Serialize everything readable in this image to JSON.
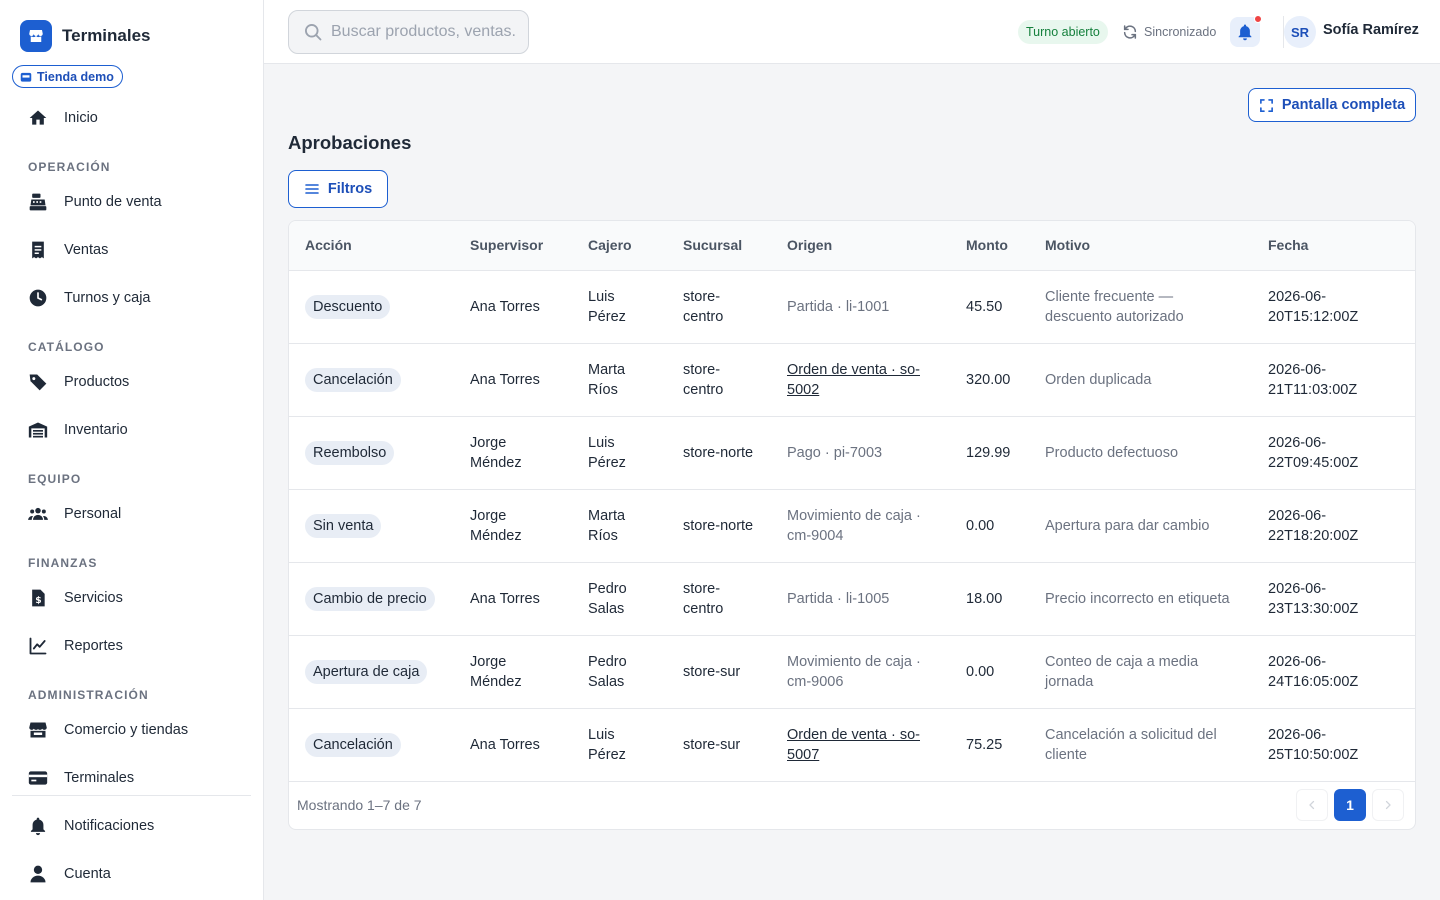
{
  "app": {
    "name": "Terminales",
    "store": "Tienda demo"
  },
  "nav": {
    "home": "Inicio",
    "sections": {
      "operation": "OPERACIÓN",
      "catalog": "CATÁLOGO",
      "team": "EQUIPO",
      "finance": "FINANZAS",
      "admin": "ADMINISTRACIÓN"
    },
    "items": {
      "pos": "Punto de venta",
      "sales": "Ventas",
      "shifts": "Turnos y caja",
      "products": "Productos",
      "inventory": "Inventario",
      "staff": "Personal",
      "services": "Servicios",
      "reports": "Reportes",
      "stores": "Comercio y tiendas",
      "terminals": "Terminales",
      "notifications": "Notificaciones",
      "account": "Cuenta"
    }
  },
  "topbar": {
    "search_placeholder": "Buscar productos, ventas...",
    "shift_status": "Turno abierto",
    "sync_status": "Sincronizado",
    "user_initials": "SR",
    "user_name": "Sofía Ramírez"
  },
  "page": {
    "title": "Aprobaciones",
    "fullscreen_label": "Pantalla completa",
    "filters_label": "Filtros"
  },
  "table": {
    "columns": {
      "action": "Acción",
      "supervisor": "Supervisor",
      "cashier": "Cajero",
      "branch": "Sucursal",
      "origin": "Origen",
      "amount": "Monto",
      "reason": "Motivo",
      "date": "Fecha"
    },
    "rows": [
      {
        "action": "Descuento",
        "supervisor": "Ana Torres",
        "cashier": "Luis Pérez",
        "branch": "store-centro",
        "origin": "Partida · li-1001",
        "origin_link": false,
        "amount": "45.50",
        "reason": "Cliente frecuente — descuento autorizado",
        "date": "2026-06-20T15:12:00Z"
      },
      {
        "action": "Cancelación",
        "supervisor": "Ana Torres",
        "cashier": "Marta Ríos",
        "branch": "store-centro",
        "origin": "Orden de venta · so-5002",
        "origin_link": true,
        "amount": "320.00",
        "reason": "Orden duplicada",
        "date": "2026-06-21T11:03:00Z"
      },
      {
        "action": "Reembolso",
        "supervisor": "Jorge Méndez",
        "cashier": "Luis Pérez",
        "branch": "store-norte",
        "origin": "Pago · pi-7003",
        "origin_link": false,
        "amount": "129.99",
        "reason": "Producto defectuoso",
        "date": "2026-06-22T09:45:00Z"
      },
      {
        "action": "Sin venta",
        "supervisor": "Jorge Méndez",
        "cashier": "Marta Ríos",
        "branch": "store-norte",
        "origin": "Movimiento de caja · cm-9004",
        "origin_link": false,
        "amount": "0.00",
        "reason": "Apertura para dar cambio",
        "date": "2026-06-22T18:20:00Z"
      },
      {
        "action": "Cambio de precio",
        "supervisor": "Ana Torres",
        "cashier": "Pedro Salas",
        "branch": "store-centro",
        "origin": "Partida · li-1005",
        "origin_link": false,
        "amount": "18.00",
        "reason": "Precio incorrecto en etiqueta",
        "date": "2026-06-23T13:30:00Z"
      },
      {
        "action": "Apertura de caja",
        "supervisor": "Jorge Méndez",
        "cashier": "Pedro Salas",
        "branch": "store-sur",
        "origin": "Movimiento de caja · cm-9006",
        "origin_link": false,
        "amount": "0.00",
        "reason": "Conteo de caja a media jornada",
        "date": "2026-06-24T16:05:00Z"
      },
      {
        "action": "Cancelación",
        "supervisor": "Ana Torres",
        "cashier": "Luis Pérez",
        "branch": "store-sur",
        "origin": "Orden de venta · so-5007",
        "origin_link": true,
        "amount": "75.25",
        "reason": "Cancelación a solicitud del cliente",
        "date": "2026-06-25T10:50:00Z"
      }
    ],
    "showing": "Mostrando 1–7 de 7",
    "current_page": "1"
  },
  "colors": {
    "accent": "#1d5fd1",
    "success": "#15803d",
    "alert": "#ef4444"
  }
}
